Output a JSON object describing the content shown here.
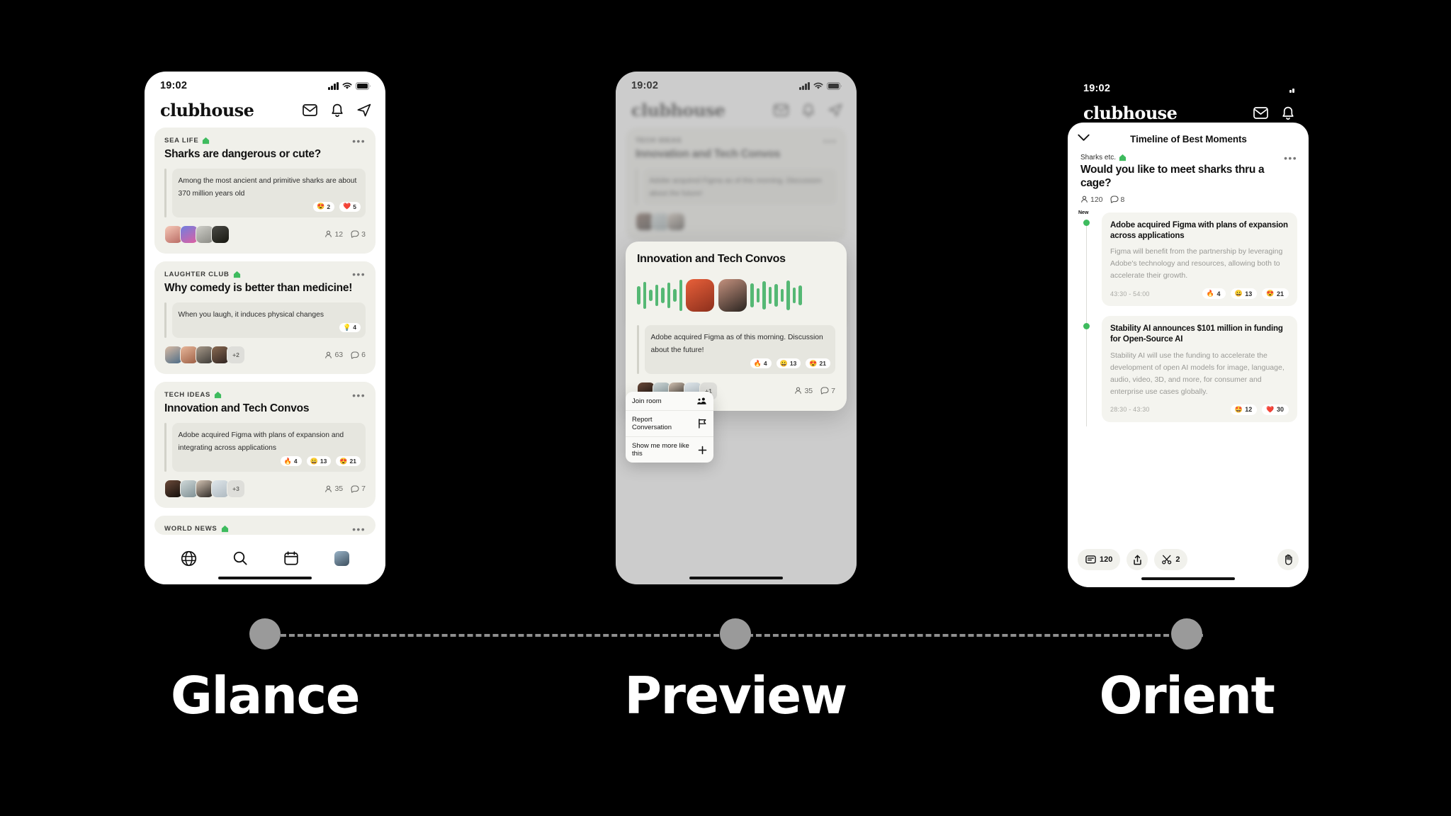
{
  "status_bar": {
    "time": "19:02"
  },
  "app": {
    "name": "clubhouse"
  },
  "header_icons": {
    "mail": "mail-icon",
    "bell": "bell-icon",
    "send": "send-icon"
  },
  "phone1": {
    "cards": [
      {
        "club": "SEA LIFE",
        "title": "Sharks are dangerous or cute?",
        "quote": "Among the most ancient and primitive sharks are about 370 million years old",
        "reactions": [
          {
            "emoji": "😍",
            "count": "2"
          },
          {
            "emoji": "❤️",
            "count": "5"
          }
        ],
        "extra_avatars": "",
        "listeners": "12",
        "comments": "3"
      },
      {
        "club": "LAUGHTER CLUB",
        "title": "Why comedy is better than medicine!",
        "quote": "When you laugh, it induces physical changes",
        "reactions": [
          {
            "emoji": "💡",
            "count": "4"
          }
        ],
        "extra_avatars": "+2",
        "listeners": "63",
        "comments": "6"
      },
      {
        "club": "TECH IDEAS",
        "title": "Innovation and Tech Convos",
        "quote": "Adobe acquired Figma with plans of expansion and integrating across applications",
        "reactions": [
          {
            "emoji": "🔥",
            "count": "4"
          },
          {
            "emoji": "😀",
            "count": "13"
          },
          {
            "emoji": "😍",
            "count": "21"
          }
        ],
        "extra_avatars": "+3",
        "listeners": "35",
        "comments": "7"
      },
      {
        "club": "WORLD NEWS",
        "title": "",
        "quote": "",
        "reactions": [],
        "extra_avatars": "",
        "listeners": "",
        "comments": ""
      }
    ],
    "tabs": [
      {
        "name": "tab-home",
        "icon": "globe-icon"
      },
      {
        "name": "tab-search",
        "icon": "search-icon"
      },
      {
        "name": "tab-calendar",
        "icon": "calendar-icon"
      },
      {
        "name": "tab-profile",
        "icon": "avatar-icon"
      }
    ]
  },
  "phone2": {
    "modal": {
      "title": "Innovation and Tech Convos",
      "quote": "Adobe acquired Figma as of this morning. Discussion about the future!",
      "reactions": [
        {
          "emoji": "🔥",
          "count": "4"
        },
        {
          "emoji": "😀",
          "count": "13"
        },
        {
          "emoji": "😍",
          "count": "21"
        }
      ],
      "extra_avatars": "+1",
      "listeners": "35",
      "comments": "7"
    },
    "context_menu": [
      {
        "label": "Join room",
        "icon": "people-add-icon"
      },
      {
        "label": "Report Conversation",
        "icon": "flag-icon"
      },
      {
        "label": "Show me more like this",
        "icon": "plus-icon"
      }
    ],
    "background_card_title": "Innovation and Tech Convos",
    "background_card_quote": "Adobe acquired Figma as of this morning. Discussion about the future!"
  },
  "phone3": {
    "sheet_title": "Timeline of Best Moments",
    "room": {
      "club": "Sharks etc.",
      "title": "Would you like to meet sharks thru a cage?",
      "listeners": "120",
      "comments": "8"
    },
    "timeline": [
      {
        "badge": "New",
        "title": "Adobe acquired Figma with plans of expansion across applications",
        "description": "Figma will benefit from the partnership by leveraging Adobe's technology and resources, allowing both  to accelerate their growth.",
        "time": "43:30  -  54:00",
        "reactions": [
          {
            "emoji": "🔥",
            "count": "4"
          },
          {
            "emoji": "😀",
            "count": "13"
          },
          {
            "emoji": "😍",
            "count": "21"
          }
        ]
      },
      {
        "badge": "",
        "title": "Stability AI announces $101 million in funding for Open-Source AI",
        "description": "Stability AI will use the funding to accelerate the development of open AI models for image, language, audio, video, 3D, and more, for consumer and enterprise use cases globally.",
        "time": "28:30  -  43:30",
        "reactions": [
          {
            "emoji": "🤩",
            "count": "12"
          },
          {
            "emoji": "❤️",
            "count": "30"
          }
        ]
      }
    ],
    "actions": [
      {
        "name": "comments-action",
        "icon": "chat-icon",
        "label": "120"
      },
      {
        "name": "share-action",
        "icon": "share-icon",
        "label": ""
      },
      {
        "name": "clip-action",
        "icon": "scissors-icon",
        "label": "2"
      },
      {
        "name": "raise-hand-action",
        "icon": "hand-icon",
        "label": ""
      }
    ]
  },
  "stages": [
    {
      "label": "Glance"
    },
    {
      "label": "Preview"
    },
    {
      "label": "Orient"
    }
  ],
  "colors": {
    "green": "#3ebb5e",
    "card_bg": "#f0f0ea",
    "background": "#000000"
  }
}
